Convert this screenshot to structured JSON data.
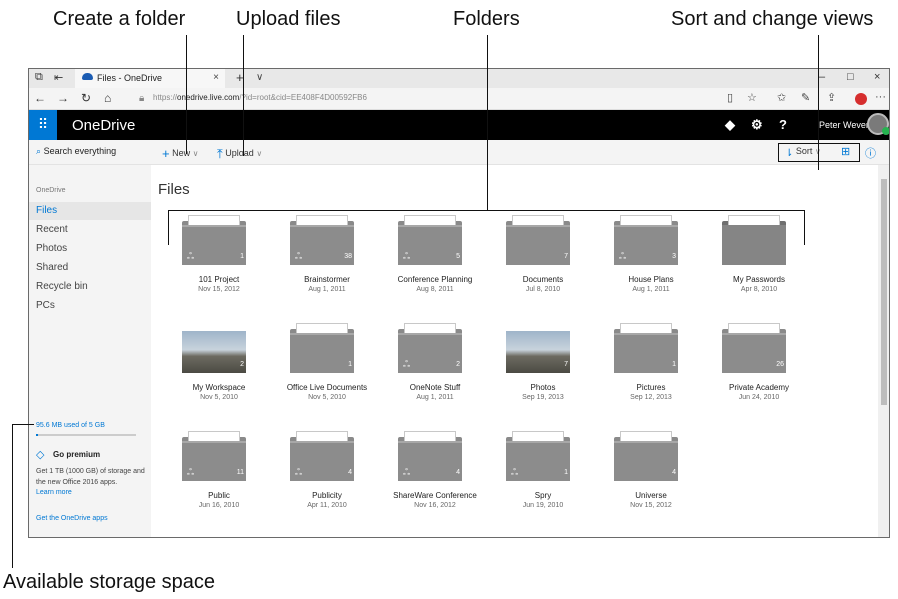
{
  "callouts": {
    "create_folder": "Create a folder",
    "upload_files": "Upload files",
    "folders": "Folders",
    "sort_views": "Sort and change views",
    "storage": "Available storage space"
  },
  "browser": {
    "tab_title": "Files - OneDrive",
    "tab_close": "×",
    "new_tab": "+",
    "tab_menu": "∨",
    "url_prefix": "https://",
    "url_host": "onedrive.live.com",
    "url_path": "/?id=root&cid=EE408F4D00592FB6",
    "icons": [
      "back-icon",
      "forward-icon",
      "refresh-icon",
      "home-icon",
      "lock-icon",
      "reading-view-icon",
      "favorite-star-icon",
      "favorites-hub-icon",
      "pen-icon",
      "share-icon",
      "extension-icon",
      "more-icon"
    ],
    "window_buttons": [
      "–",
      "□",
      "×"
    ]
  },
  "app": {
    "brand": "OneDrive",
    "user_name": "Peter Weverka",
    "help_label": "?"
  },
  "command_bar": {
    "search_placeholder": "Search everything",
    "new_label": "New",
    "upload_label": "Upload",
    "sort_label": "Sort"
  },
  "sidebar": {
    "title": "OneDrive",
    "items": [
      {
        "label": "Files",
        "active": true
      },
      {
        "label": "Recent",
        "active": false
      },
      {
        "label": "Photos",
        "active": false
      },
      {
        "label": "Shared",
        "active": false
      },
      {
        "label": "Recycle bin",
        "active": false
      },
      {
        "label": "PCs",
        "active": false
      }
    ],
    "storage_text": "95.6 MB used of 5 GB",
    "storage_fraction": 0.02,
    "premium_title": "Go premium",
    "premium_desc": "Get 1 TB (1000 GB) of storage and the new Office 2016 apps.",
    "learn_more": "Learn more",
    "get_apps": "Get the OneDrive apps"
  },
  "main": {
    "title": "Files",
    "folders": [
      {
        "name": "101 Project",
        "date": "Nov 15, 2012",
        "count": "1",
        "shared": true,
        "photo": false
      },
      {
        "name": "Brainstormer",
        "date": "Aug 1, 2011",
        "count": "38",
        "shared": true,
        "photo": false
      },
      {
        "name": "Conference Planning",
        "date": "Aug 8, 2011",
        "count": "5",
        "shared": true,
        "photo": false
      },
      {
        "name": "Documents",
        "date": "Jul 8, 2010",
        "count": "7",
        "shared": false,
        "photo": false
      },
      {
        "name": "House Plans",
        "date": "Aug 1, 2011",
        "count": "3",
        "shared": true,
        "photo": false
      },
      {
        "name": "My Passwords",
        "date": "Apr 8, 2010",
        "count": "",
        "shared": false,
        "photo": false,
        "vault": true
      },
      {
        "name": "My Workspace",
        "date": "Nov 5, 2010",
        "count": "2",
        "shared": false,
        "photo": true
      },
      {
        "name": "Office Live Documents",
        "date": "Nov 5, 2010",
        "count": "1",
        "shared": false,
        "photo": false
      },
      {
        "name": "OneNote Stuff",
        "date": "Aug 1, 2011",
        "count": "2",
        "shared": true,
        "photo": false
      },
      {
        "name": "Photos",
        "date": "Sep 19, 2013",
        "count": "7",
        "shared": false,
        "photo": true
      },
      {
        "name": "Pictures",
        "date": "Sep 12, 2013",
        "count": "1",
        "shared": false,
        "photo": false
      },
      {
        "name": "Private Academy",
        "date": "Jun 24, 2010",
        "count": "26",
        "shared": false,
        "photo": false
      },
      {
        "name": "Public",
        "date": "Jun 16, 2010",
        "count": "11",
        "shared": true,
        "photo": false
      },
      {
        "name": "Publicity",
        "date": "Apr 11, 2010",
        "count": "4",
        "shared": true,
        "photo": false
      },
      {
        "name": "ShareWare Conference",
        "date": "Nov 16, 2012",
        "count": "4",
        "shared": true,
        "photo": false
      },
      {
        "name": "Spry",
        "date": "Jun 19, 2010",
        "count": "1",
        "shared": true,
        "photo": false
      },
      {
        "name": "Universe",
        "date": "Nov 15, 2012",
        "count": "4",
        "shared": false,
        "photo": false
      }
    ]
  }
}
